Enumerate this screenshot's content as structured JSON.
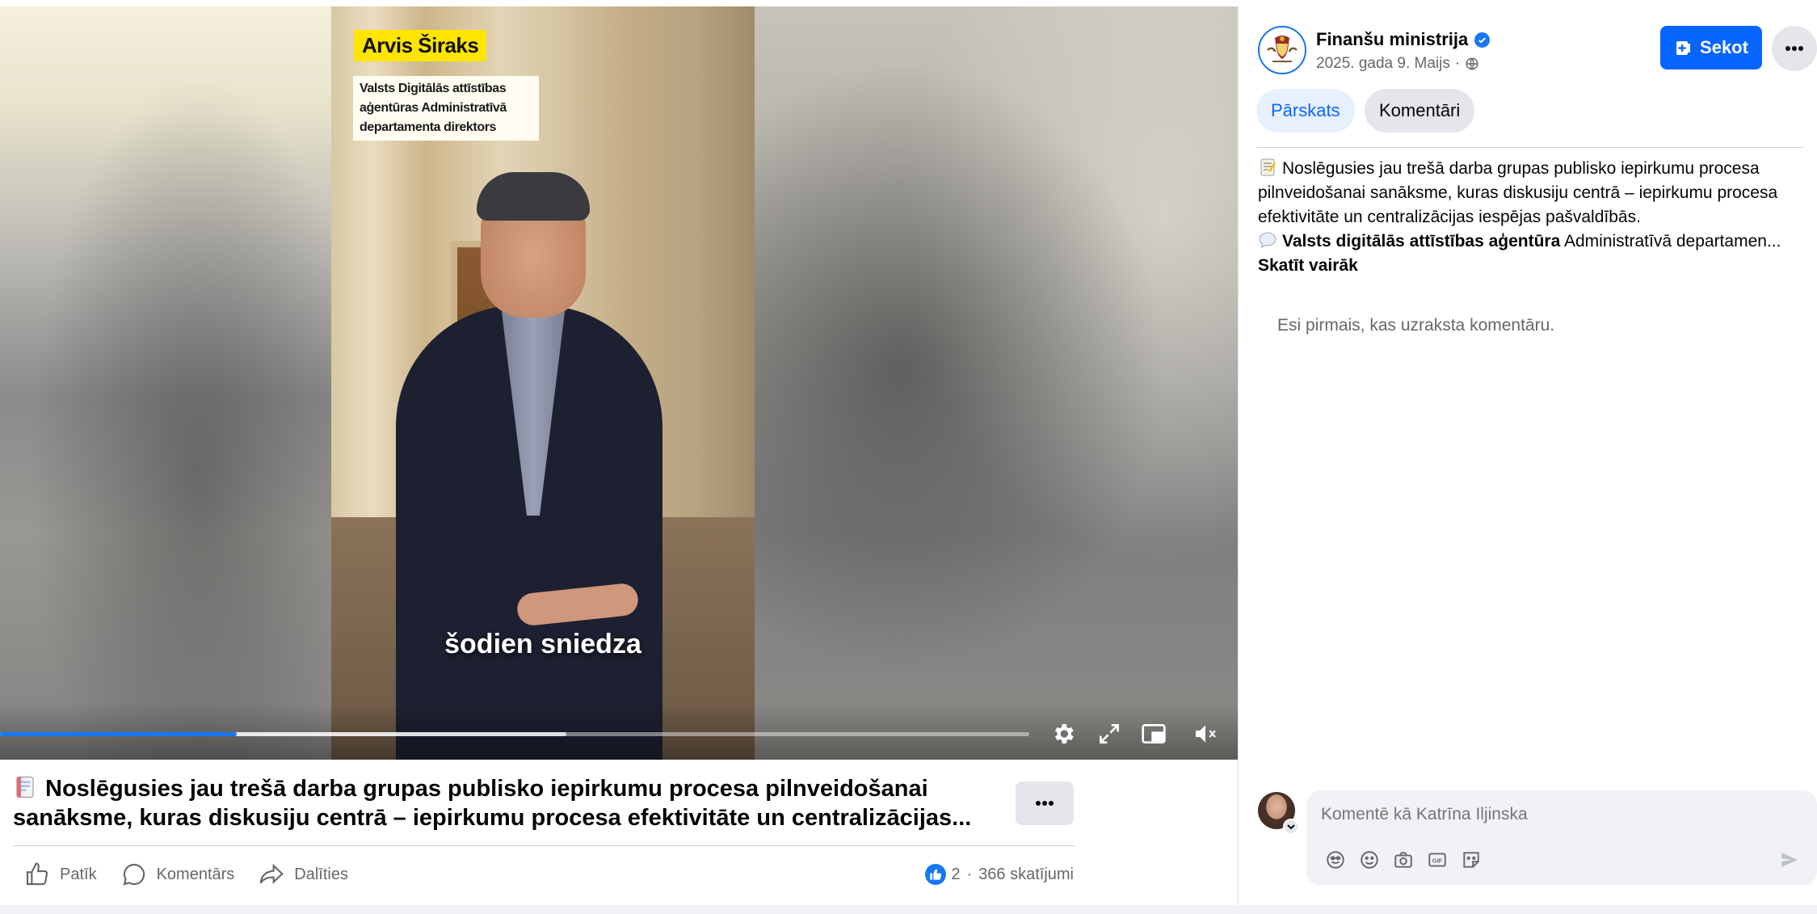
{
  "video": {
    "overlay_name": "Arvis Širaks",
    "overlay_title": "Valsts Digitālās attīstības aģentūras Administratīvā departamenta direktors",
    "caption": "šodien sniedza",
    "progress": 0.23,
    "buffered": 0.55,
    "controls": [
      "settings-icon",
      "fullscreen-icon",
      "picture-in-picture-icon",
      "mute-icon"
    ]
  },
  "post": {
    "title": "Noslēgusies jau trešā darba grupas publisko iepirkumu procesa pilnveidošanai sanāksme, kuras diskusiju centrā – iepirkumu procesa efektivitāte un centralizācijas...",
    "actions": {
      "like": "Patīk",
      "comment": "Komentārs",
      "share": "Dalīties"
    },
    "reactions_count": "2",
    "views": "366 skatījumi",
    "separator": "·"
  },
  "sidebar": {
    "page_name": "Finanšu ministrija",
    "date": "2025. gada 9. Maijs",
    "date_separator": "·",
    "follow_label": "Sekot",
    "tabs": {
      "overview": "Pārskats",
      "comments": "Komentāri"
    },
    "description": {
      "line1": "Noslēgusies jau trešā darba grupas publisko iepirkumu procesa pilnveidošanai sanāksme, kuras diskusiju centrā – iepirkumu procesa efektivitāte un centralizācijas iespējas pašvaldībās.",
      "line2_bold": "Valsts digitālās attīstības aģentūra",
      "line2_rest": " Administratīvā departamen...",
      "see_more": "Skatīt vairāk"
    },
    "empty_comments": "Esi pirmais, kas uzraksta komentāru.",
    "comment_placeholder": "Komentē kā Katrīna Iljinska"
  },
  "colors": {
    "accent": "#0866ff",
    "like_blue": "#1877f2",
    "overlay_yellow": "#ffe500",
    "muted_text": "#65676b"
  }
}
